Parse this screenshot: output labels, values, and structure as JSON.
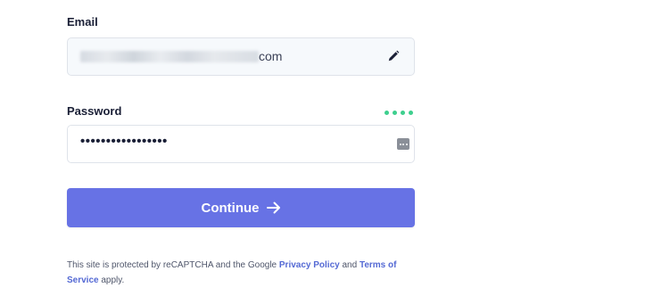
{
  "email": {
    "label": "Email",
    "value_visible_suffix": "com",
    "edit_icon": "pencil-icon"
  },
  "password": {
    "label": "Password",
    "value_masked": "•••••••••••••••••",
    "strength_dots": 4,
    "strength_color": "#3ecf8e",
    "reveal_icon": "more-dots-icon"
  },
  "continue_button": {
    "label": "Continue",
    "icon": "arrow-right-icon",
    "color": "#6772e5"
  },
  "recaptcha": {
    "prefix": "This site is protected by reCAPTCHA and the Google ",
    "privacy_link": "Privacy Policy",
    "middle": " and ",
    "terms_link": "Terms of Service",
    "suffix": " apply."
  }
}
